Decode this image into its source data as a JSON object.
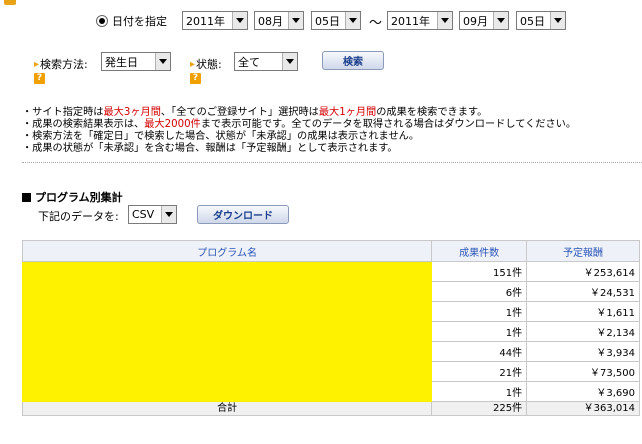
{
  "date_filter": {
    "radio_label": "日付を指定",
    "from": {
      "year": "2011年",
      "month": "08月",
      "day": "05日"
    },
    "separator": "～",
    "to": {
      "year": "2011年",
      "month": "09月",
      "day": "05日"
    }
  },
  "search": {
    "method_label": "検索方法:",
    "method_value": "発生日",
    "status_label": "状態:",
    "status_value": "全て",
    "search_button": "検索",
    "help_glyph": "?"
  },
  "notes": [
    {
      "prefix": "・サイト指定時は",
      "red1": "最大3ヶ月間",
      "mid": "、「全てのご登録サイト」選択時は",
      "red2": "最大1ヶ月間",
      "suffix": "の成果を検索できます。"
    },
    {
      "prefix": "・成果の検索結果表示は、",
      "red1": "最大2000件",
      "mid": "まで表示可能です。全てのデータを取得される場合はダウンロードしてください。",
      "red2": "",
      "suffix": ""
    },
    {
      "prefix": "・検索方法を「確定日」で検索した場合、状態が「未承認」の成果は表示されません。",
      "red1": "",
      "mid": "",
      "red2": "",
      "suffix": ""
    },
    {
      "prefix": "・成果の状態が「未承認」を含む場合、報酬は「予定報酬」として表示されます。",
      "red1": "",
      "mid": "",
      "red2": "",
      "suffix": ""
    }
  ],
  "program_summary": {
    "title": "プログラム別集計",
    "download_label": "下記のデータを:",
    "format_value": "CSV",
    "download_button": "ダウンロード",
    "columns": {
      "name": "プログラム名",
      "count": "成果件数",
      "reward": "予定報酬"
    },
    "rows": [
      {
        "count": "151件",
        "reward": "￥253,614"
      },
      {
        "count": "6件",
        "reward": "￥24,531"
      },
      {
        "count": "1件",
        "reward": "￥1,611"
      },
      {
        "count": "1件",
        "reward": "￥2,134"
      },
      {
        "count": "44件",
        "reward": "￥3,934"
      },
      {
        "count": "21件",
        "reward": "￥73,500"
      },
      {
        "count": "1件",
        "reward": "￥3,690"
      }
    ],
    "total": {
      "label": "合計",
      "count": "225件",
      "reward": "￥363,014"
    }
  }
}
